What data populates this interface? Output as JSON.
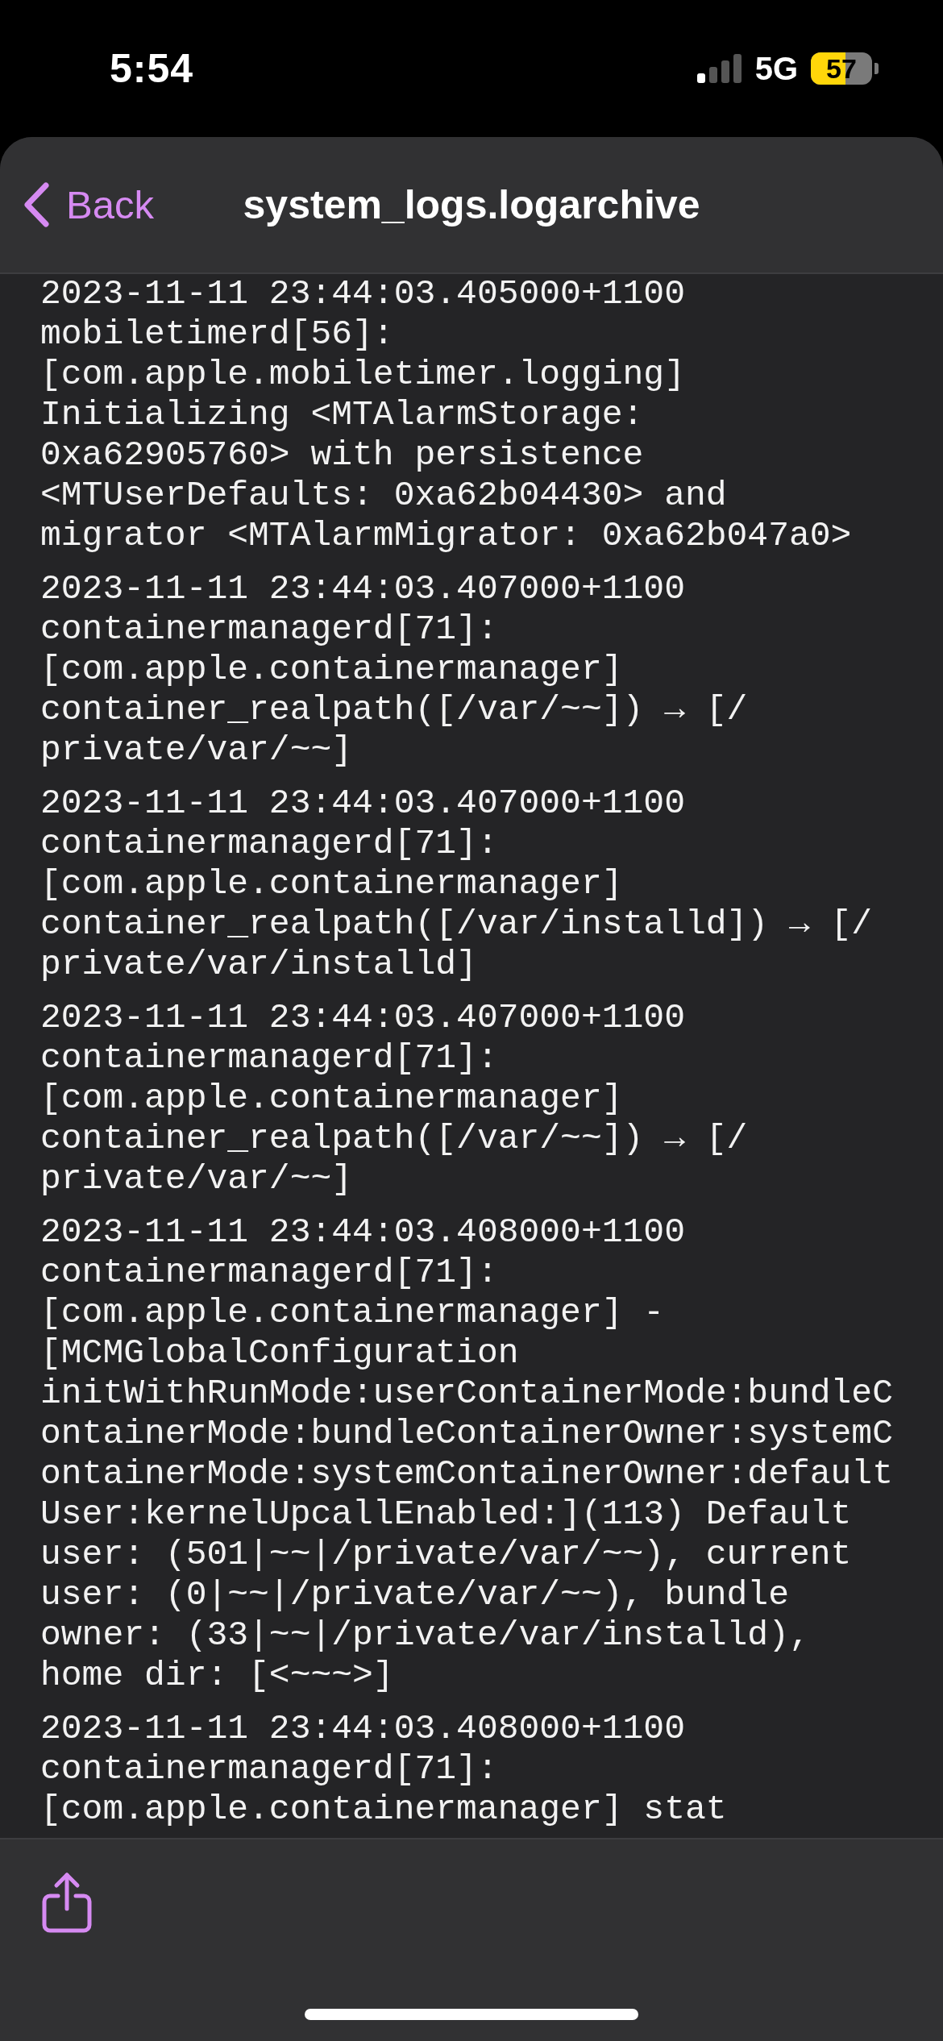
{
  "status_bar": {
    "time": "5:54",
    "network": "5G",
    "battery": "57"
  },
  "nav": {
    "back": "Back",
    "title": "system_logs.logarchive"
  },
  "entries": [
    {
      "lines": [
        "2023-11-11 23:44:03.405000+1100",
        "mobiletimerd[56]:",
        "[com.apple.mobiletimer.logging]",
        "Initializing <MTAlarmStorage:",
        "0xa62905760> with persistence",
        "<MTUserDefaults: 0xa62b04430> and",
        "migrator <MTAlarmMigrator: 0xa62b047a0>"
      ]
    },
    {
      "lines": [
        "2023-11-11 23:44:03.407000+1100",
        "containermanagerd[71]:",
        "[com.apple.containermanager]",
        "container_realpath([/var/~~]) → [/",
        "private/var/~~]"
      ]
    },
    {
      "lines": [
        "2023-11-11 23:44:03.407000+1100",
        "containermanagerd[71]:",
        "[com.apple.containermanager]",
        "container_realpath([/var/installd]) → [/",
        "private/var/installd]"
      ]
    },
    {
      "lines": [
        "2023-11-11 23:44:03.407000+1100",
        "containermanagerd[71]:",
        "[com.apple.containermanager]",
        "container_realpath([/var/~~]) → [/",
        "private/var/~~]"
      ]
    },
    {
      "lines": [
        "2023-11-11 23:44:03.408000+1100",
        "containermanagerd[71]:",
        "[com.apple.containermanager] -",
        "[MCMGlobalConfiguration",
        "initWithRunMode:userContainerMode:bundleC",
        "ontainerMode:bundleContainerOwner:systemC",
        "ontainerMode:systemContainerOwner:default",
        "User:kernelUpcallEnabled:](113) Default",
        "user: (501|~~|/private/var/~~), current",
        "user: (0|~~|/private/var/~~), bundle",
        "owner: (33|~~|/private/var/installd),",
        "home dir: [<~~~>]"
      ]
    },
    {
      "lines": [
        "2023-11-11 23:44:03.408000+1100",
        "containermanagerd[71]:",
        "[com.apple.containermanager] stat"
      ]
    }
  ]
}
